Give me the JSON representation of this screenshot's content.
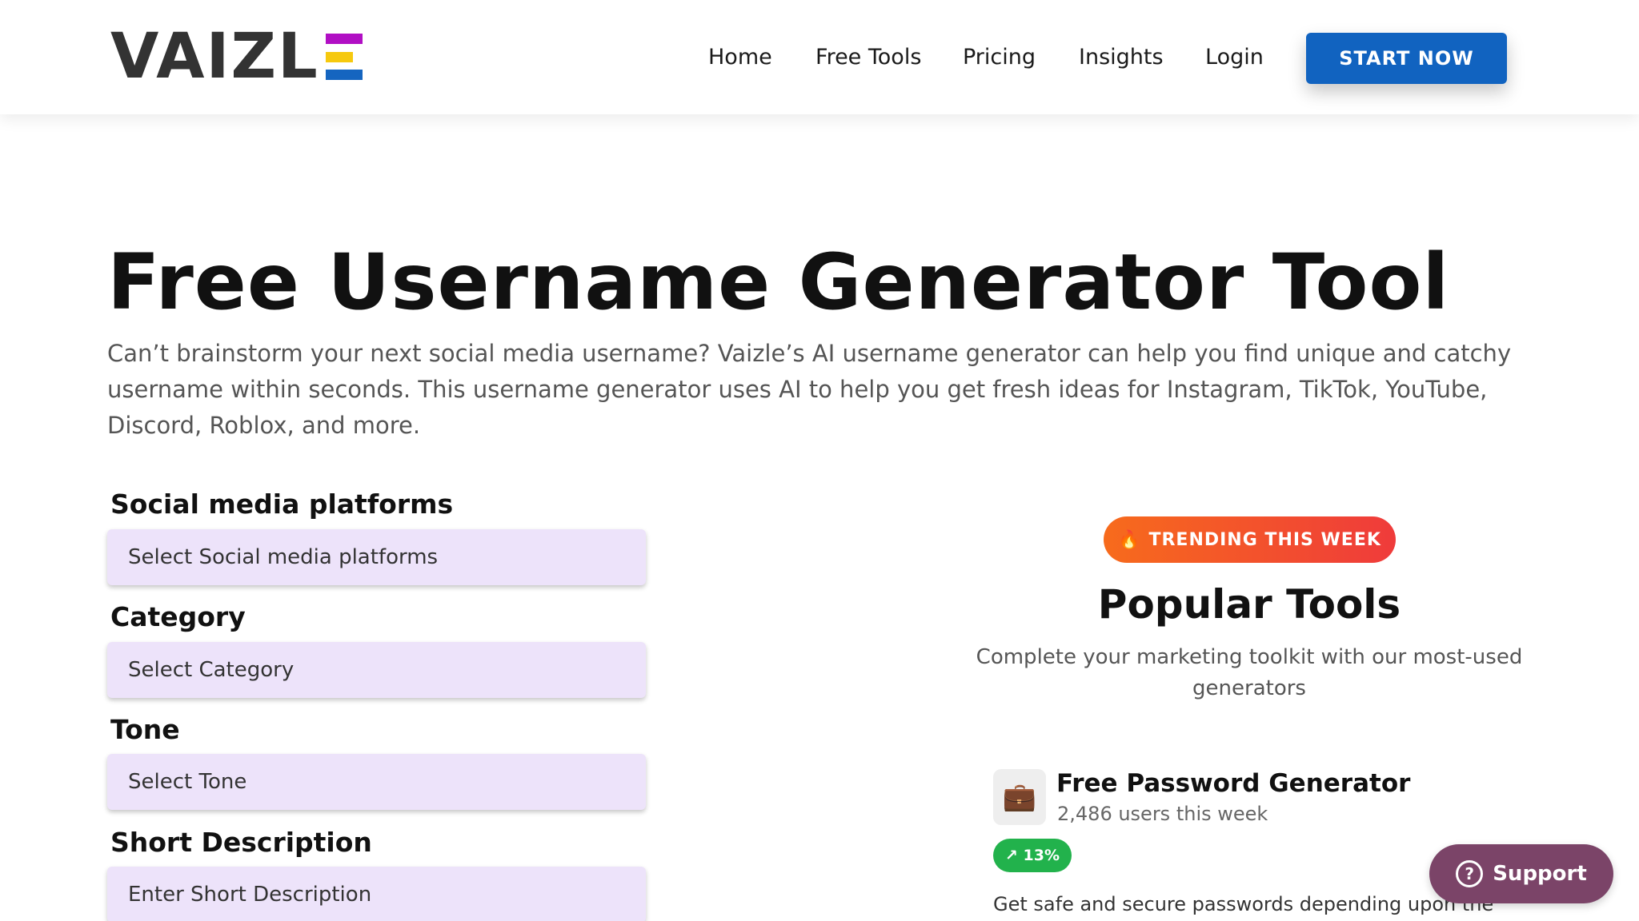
{
  "colors": {
    "brand_dark": "#333333",
    "logo_bar_1": "#b10fc4",
    "logo_bar_2": "#f6c90e",
    "logo_bar_3": "#1565c0",
    "primary_button": "#1163c0",
    "select_bg": "#ede3fa",
    "trend_gradient_start": "#f76b1c",
    "trend_gradient_end": "#ef3b3b",
    "growth_green": "#22b24c",
    "support_bg": "#7b4468"
  },
  "header": {
    "logo_text": "VAIZL",
    "nav": [
      {
        "label": "Home"
      },
      {
        "label": "Free Tools"
      },
      {
        "label": "Pricing"
      },
      {
        "label": "Insights"
      },
      {
        "label": "Login"
      }
    ],
    "cta_label": "START NOW"
  },
  "hero": {
    "title": "Free Username Generator Tool",
    "description": "Can’t brainstorm your next social media username? Vaizle’s AI username generator can help you find unique and catchy username within seconds. This username generator uses AI to help you get fresh ideas for Instagram, TikTok, YouTube, Discord, Roblox, and more."
  },
  "form": {
    "fields": [
      {
        "label": "Social media platforms",
        "placeholder": "Select Social media platforms"
      },
      {
        "label": "Category",
        "placeholder": "Select Category"
      },
      {
        "label": "Tone",
        "placeholder": "Select Tone"
      },
      {
        "label": "Short Description",
        "placeholder": "Enter Short Description"
      }
    ]
  },
  "popular": {
    "badge_icon": "flame-icon",
    "badge_label": "TRENDING THIS WEEK",
    "title": "Popular Tools",
    "subtitle": "Complete your marketing toolkit with our most-used generators",
    "tools": [
      {
        "icon": "briefcase-icon",
        "title": "Free Password Generator",
        "users": "2,486 users this week",
        "growth": "↗ 13%",
        "description": "Get safe and secure passwords depending upon the"
      }
    ]
  },
  "support": {
    "icon": "help-icon",
    "label": "Support"
  }
}
